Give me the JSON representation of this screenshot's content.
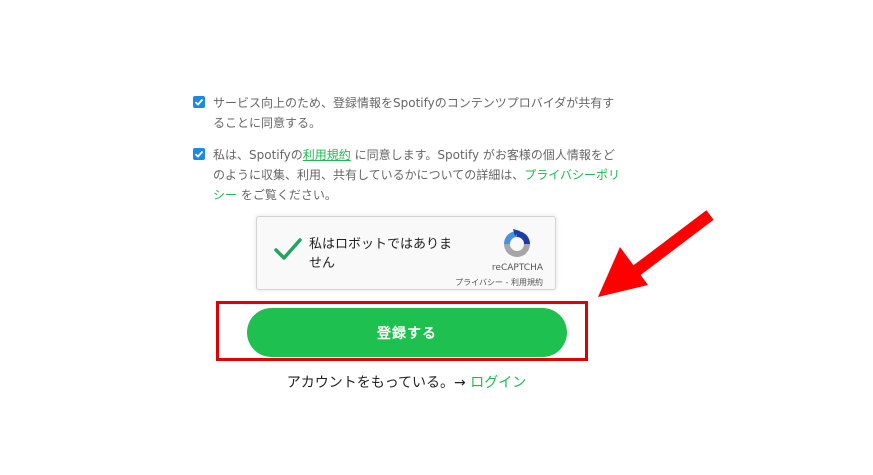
{
  "consent1": {
    "text": "サービス向上のため、登録情報をSpotifyのコンテンツプロバイダが共有することに同意する。",
    "checked": true
  },
  "consent2": {
    "prefix": "私は、Spotifyの",
    "terms_link": "利用規約",
    "middle": " に同意します。Spotify がお客様の個人情報をどのように収集、利用、共有しているかについての詳細は、",
    "privacy_link": "プライバシーポリシー",
    "suffix": " をご覧ください。",
    "checked": true
  },
  "recaptcha": {
    "label": "私はロボットではありません",
    "brand": "reCAPTCHA",
    "privacy": "プライバシー",
    "separator": " - ",
    "terms": "利用規約",
    "checkmark_icon": "check-icon",
    "logo_icon": "recaptcha-logo-icon"
  },
  "register_button": {
    "label": "登録する"
  },
  "login": {
    "prompt": "アカウントをもっている。→ ",
    "link": "ログイン"
  },
  "colors": {
    "accent_green": "#1db954",
    "button_green": "#1ec04f",
    "checkbox_blue": "#1e88e5",
    "highlight_red": "#e00000",
    "arrow_red": "#ff0000"
  }
}
